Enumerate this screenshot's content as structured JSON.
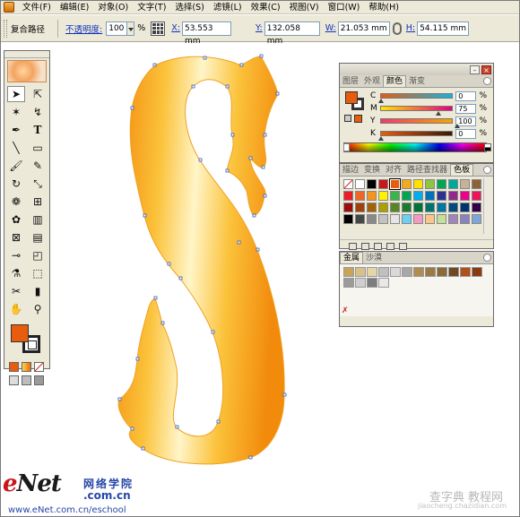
{
  "menu": {
    "items": [
      "文件(F)",
      "编辑(E)",
      "对象(O)",
      "文字(T)",
      "选择(S)",
      "滤镜(L)",
      "效果(C)",
      "视图(V)",
      "窗口(W)",
      "帮助(H)"
    ]
  },
  "control": {
    "object_type": "复合路径",
    "opacity_label": "不透明度:",
    "opacity_value": "100",
    "opacity_unit": "%",
    "x_label": "X:",
    "x_value": "53.553 mm",
    "y_label": "Y:",
    "y_value": "132.058 mm",
    "w_label": "W:",
    "w_value": "21.053 mm",
    "h_label": "H:",
    "h_value": "54.115 mm"
  },
  "color_panel": {
    "tabs": [
      "图层",
      "外观",
      "颜色",
      "渐变"
    ],
    "active_tab": "颜色",
    "channels": [
      {
        "label": "C",
        "value": "0",
        "percent": 0
      },
      {
        "label": "M",
        "value": "75",
        "percent": 75
      },
      {
        "label": "Y",
        "value": "100",
        "percent": 100
      },
      {
        "label": "K",
        "value": "0",
        "percent": 0
      }
    ],
    "percent_sign": "%",
    "fill_color": "#e85c0d"
  },
  "swatch_panel": {
    "tabs": [
      "描边",
      "变换",
      "对齐",
      "路径查找器",
      "色板"
    ],
    "active_tab": "色板",
    "colors": [
      "#ffffff",
      "#ffffff",
      "#000000",
      "#c9161b",
      "#e85c0d",
      "#f7a81b",
      "#ffe200",
      "#8dc63f",
      "#00a651",
      "#00a99d",
      "#c7b299",
      "#8c6239",
      "#ed1c24",
      "#f26522",
      "#f7941d",
      "#fff200",
      "#39b54a",
      "#00a651",
      "#00aeef",
      "#0072bc",
      "#2e3192",
      "#92278f",
      "#ec008c",
      "#ed145b",
      "#9e0b0f",
      "#a0410d",
      "#a36209",
      "#aba000",
      "#598527",
      "#1a7b30",
      "#007236",
      "#00746b",
      "#0076a3",
      "#004a80",
      "#003471",
      "#32004b",
      "#000000",
      "#464646",
      "#898989",
      "#c2c2c2",
      "#e6e6e6",
      "#6dcff6",
      "#f49ac2",
      "#fdc689",
      "#c4df9b",
      "#a186be",
      "#8882be",
      "#7da7d9"
    ],
    "selected_index": 4
  },
  "metal_panel": {
    "tabs": [
      "金属",
      "沙漠"
    ],
    "active_tab": "金属",
    "colors": [
      "#c8a35a",
      "#d7c08a",
      "#e4d6a7",
      "#bfbfbf",
      "#d9d9d9",
      "#a8a8a8",
      "#b18c52",
      "#9b7b45",
      "#8a6a39",
      "#6c4b24",
      "#b1501a",
      "#8a3a0f",
      "#9b9b9b",
      "#cfcfcf",
      "#7d7d7d",
      "#e8e8e8"
    ]
  },
  "watermark": {
    "brand_e": "e",
    "brand_net": "Net",
    "brand_cn": "网络学院",
    "brand_domain": ".com.cn",
    "url": "www.eNet.com.cn/eschool",
    "site": "查字典 教程网",
    "site_sub": "jiaocheng.chazidian.com"
  },
  "artwork": {
    "gradient_outer": "#f28a0c",
    "gradient_mid": "#fbc23a",
    "gradient_inner": "#fff5c8"
  }
}
